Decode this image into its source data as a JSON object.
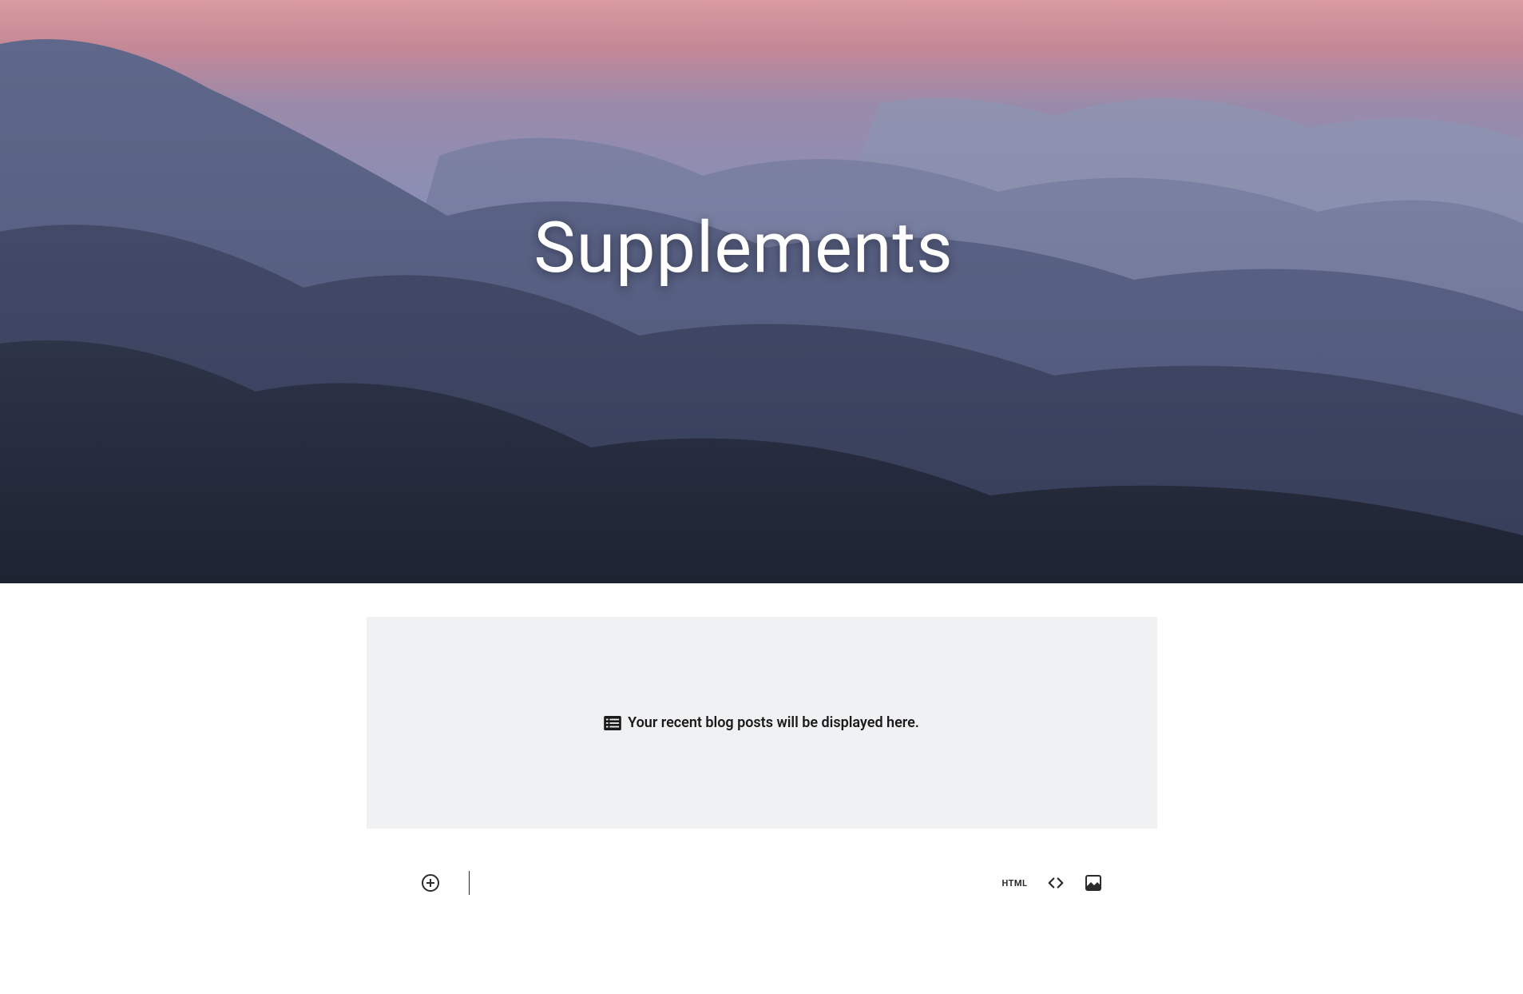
{
  "hero": {
    "title": "Supplements"
  },
  "placeholder": {
    "message": "Your recent blog posts will be displayed here."
  },
  "toolbar": {
    "html_label": "HTML"
  }
}
